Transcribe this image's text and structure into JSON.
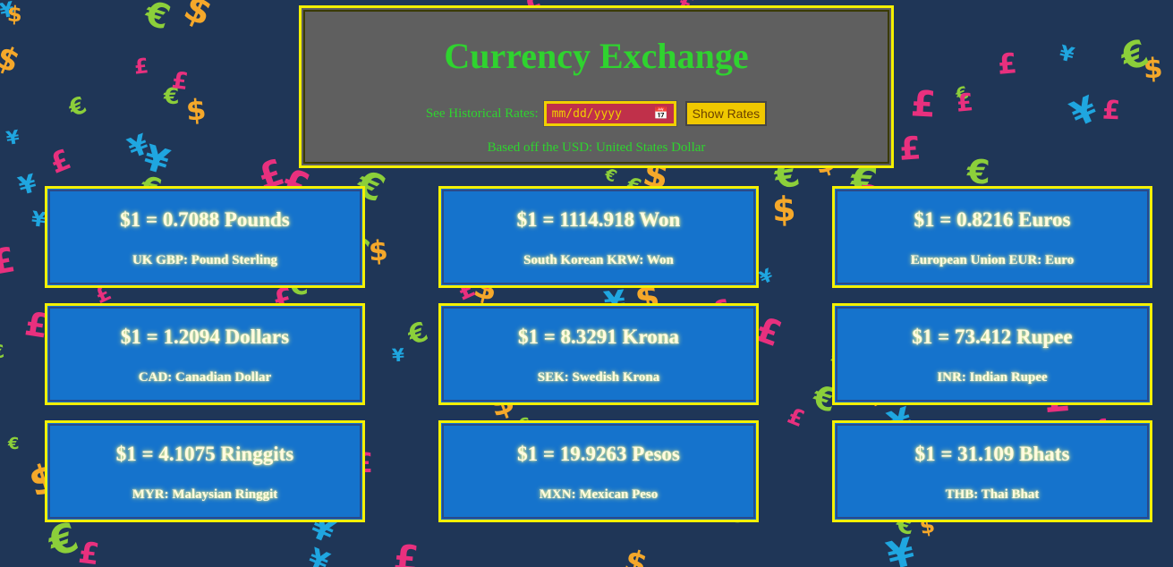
{
  "header": {
    "title": "Currency Exchange",
    "historical_label": "See Historical Rates:",
    "date_placeholder": "mm/dd/yyyy",
    "calendar_icon": "calendar-icon",
    "show_rates_label": "Show Rates",
    "based_text": "Based off the USD: United States Dollar"
  },
  "cards": [
    {
      "rate": "$1 = 0.7088 Pounds",
      "name": "UK GBP: Pound Sterling"
    },
    {
      "rate": "$1 = 1114.918 Won",
      "name": "South Korean KRW: Won"
    },
    {
      "rate": "$1 = 0.8216 Euros",
      "name": "European Union EUR: Euro"
    },
    {
      "rate": "$1 = 1.2094 Dollars",
      "name": "CAD: Canadian Dollar"
    },
    {
      "rate": "$1 = 8.3291 Krona",
      "name": "SEK: Swedish Krona"
    },
    {
      "rate": "$1 = 73.412 Rupee",
      "name": "INR: Indian Rupee"
    },
    {
      "rate": "$1 = 4.1075 Ringgits",
      "name": "MYR: Malaysian Ringgit"
    },
    {
      "rate": "$1 = 19.9263 Pesos",
      "name": "MXN: Mexican Peso"
    },
    {
      "rate": "$1 = 31.109 Bhats",
      "name": "THB: Thai Bhat"
    }
  ],
  "colors": {
    "background": "#1f3657",
    "header_bg": "#5f5f5f",
    "accent_green": "#2fd32f",
    "border_yellow": "#f4f000",
    "card_bg": "#1573cc"
  }
}
